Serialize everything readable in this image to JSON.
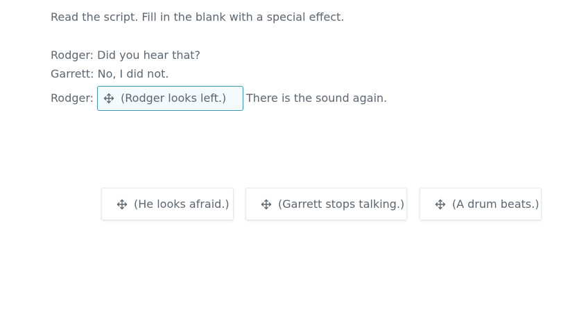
{
  "instructions": "Read the script. Fill in the blank with a special effect.",
  "script": {
    "line1": "Rodger: Did you hear that?",
    "line2": "Garrett: No, I did not.",
    "line3_prefix": "Rodger:",
    "line3_suffix": "There is the sound again."
  },
  "drop_slot": {
    "icon": "move-icon",
    "value": "(Rodger looks left.)"
  },
  "answer_choices": [
    {
      "icon": "move-icon",
      "label": "(He looks afraid.)"
    },
    {
      "icon": "move-icon",
      "label": "(Garrett stops talking.)"
    },
    {
      "icon": "move-icon",
      "label": "(A drum beats.)"
    }
  ],
  "colors": {
    "text": "#5b6670",
    "slot_border": "#3a9ab4",
    "slot_fill": "#f4fafd",
    "tile_border": "#e6e9ec"
  }
}
